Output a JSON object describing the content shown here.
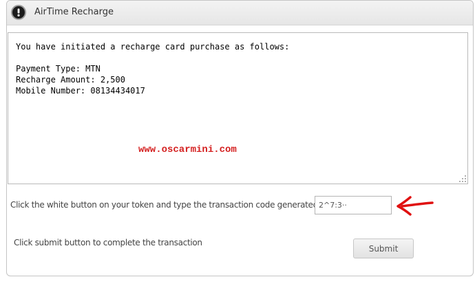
{
  "window": {
    "title": "AirTime Recharge",
    "icon": "alert-icon"
  },
  "message": {
    "lines": [
      "You have initiated a recharge card purchase as follows:",
      "",
      "Payment Type: MTN",
      "Recharge Amount: 2,500",
      "Mobile Number: 08134434017"
    ],
    "watermark": "www.oscarmini.com"
  },
  "code_prompt": {
    "label": "Click the white button on your token and type the transaction code generated:",
    "input_value": "2^7:3··"
  },
  "instruction": "Click submit button to complete the transaction",
  "submit_label": "Submit",
  "colors": {
    "watermark": "#d42020",
    "arrow": "#e01010"
  }
}
